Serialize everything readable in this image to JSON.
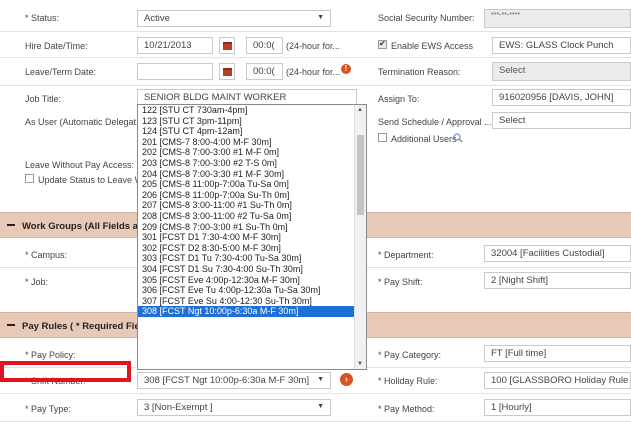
{
  "left": {
    "status_label": "* Status:",
    "status_value": "Active",
    "hire_label": "Hire Date/Time:",
    "hire_date": "10/21/2013",
    "hire_time": "00:0(",
    "hire_hint": "(24-hour for...",
    "leave_label": "Leave/Term Date:",
    "leave_time": "00:0(",
    "leave_hint": "(24-hour for...",
    "job_label": "Job Title:",
    "job_value": "SENIOR BLDG MAINT WORKER",
    "as_user_label": "As User (Automatic Delegat...",
    "lwop_label": "Leave Without Pay Access:",
    "update_status_label": "Update Status to Leave Wi"
  },
  "right": {
    "ssn_label": "Social Security Number:",
    "ssn_value": "***-**-****",
    "ews_label": "Enable EWS Access",
    "ews_value": "EWS: GLASS Clock Punch",
    "term_label": "Termination Reason:",
    "term_value": "Select",
    "assign_label": "Assign To:",
    "assign_value": "916020956 [DAVIS, JOHN]",
    "send_label": "Send Schedule / Approval ...",
    "send_value": "Select",
    "additional_users_label": "Additional Users"
  },
  "work_groups": {
    "title": "Work Groups (All Fields ar",
    "campus_label": "* Campus:",
    "job_label": "* Job:",
    "department_label": "* Department:",
    "department_value": "32004 [Facilities Custodial]",
    "pay_shift_label": "* Pay Shift:",
    "pay_shift_value": "2 [Night Shift]"
  },
  "pay_rules": {
    "title": "Pay Rules ( * Required Fie",
    "policy_label": "* Pay Policy:",
    "shift_number_label": "* Shift Number:",
    "shift_number_value": "308 [FCST Ngt 10:00p-6:30a M-F 30m]",
    "pay_type_label": "* Pay Type:",
    "pay_type_value": "3 [Non-Exempt ]",
    "category_label": "* Pay Category:",
    "category_value": "FT [Full time]",
    "holiday_label": "* Holiday Rule:",
    "holiday_value": "100 [GLASSBORO Holiday Rule",
    "method_label": "* Pay Method:",
    "method_value": "1 [Hourly]"
  },
  "shift_options": [
    "122 [STU CT 730am-4pm]",
    "123 [STU CT 3pm-11pm]",
    "124 [STU CT 4pm-12am]",
    "201 [CMS-7 8:00-4:00 M-F 30m]",
    "202 [CMS-8 7:00-3:00 #1 M-F 0m]",
    "203 [CMS-8 7:00-3:00 #2 T-S 0m]",
    "204 [CMS-8 7:00-3:30 #1 M-F 30m]",
    "205 [CMS-8 11:00p-7:00a Tu-Sa 0m]",
    "206 [CMS-8 11:00p-7:00a Su-Th 0m]",
    "207 [CMS-8 3:00-11:00 #1 Su-Th 0m]",
    "208 [CMS-8 3:00-11:00 #2 Tu-Sa 0m]",
    "209 [CMS-8 7:00-3:00 #1 Su-Th 0m]",
    "301 [FCST D1 7:30-4:00 M-F 30m]",
    "302 [FCST D2 8:30-5:00 M-F 30m]",
    "303 [FCST D1 Tu 7:30-4:00 Tu-Sa 30m]",
    "304 [FCST D1 Su 7:30-4:00 Su-Th 30m]",
    "305 [FCST Eve 4:00p-12:30a M-F 30m]",
    "306 [FCST Eve Tu 4:00p-12:30a Tu-Sa 30m]",
    "307 [FCST Eve Su 4:00-12:30 Su-Th 30m]",
    "308 [FCST Ngt 10:00p-6:30a M-F 30m]"
  ]
}
